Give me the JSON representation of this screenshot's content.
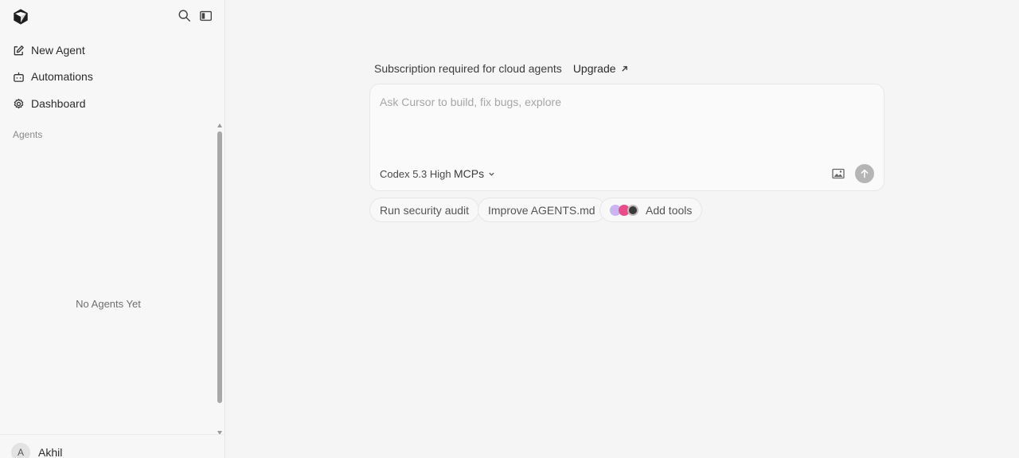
{
  "sidebar": {
    "nav": [
      {
        "label": "New Agent",
        "icon": "edit-icon"
      },
      {
        "label": "Automations",
        "icon": "robot-icon"
      },
      {
        "label": "Dashboard",
        "icon": "gear-icon"
      }
    ],
    "section_label": "Agents",
    "empty_text": "No Agents Yet",
    "user": {
      "initial": "A",
      "name": "Akhil"
    }
  },
  "main": {
    "notice": "Subscription required for cloud agents",
    "upgrade_label": "Upgrade",
    "composer": {
      "placeholder": "Ask Cursor to build, fix bugs, explore",
      "model": "Codex 5.3 High",
      "mcps_label": "MCPs"
    },
    "suggestions": [
      "Run security audit",
      "Improve AGENTS.md",
      "Add tools"
    ]
  },
  "colors": {
    "background": "#f5f5f5",
    "send_button": "#b5b5b5"
  }
}
